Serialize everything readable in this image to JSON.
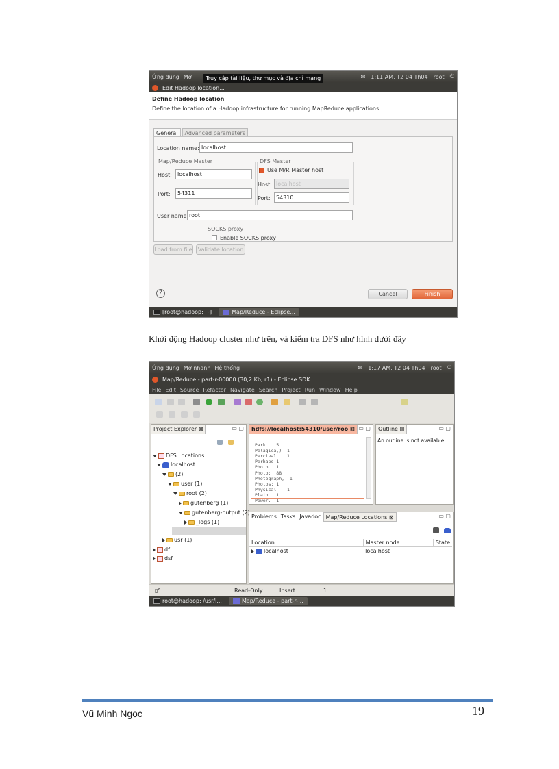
{
  "screenshot1": {
    "topbar": {
      "apps": "Ứng dụng",
      "places": "Mơ",
      "clock": "1:11 AM, T2 04 Th04",
      "user": "root"
    },
    "tooltip": "Truy cập tài liệu, thư mục và địa chỉ mạng",
    "dialog_title": "Edit Hadoop location...",
    "header_title": "Define Hadoop location",
    "header_desc": "Define the location of a Hadoop infrastructure for running MapReduce applications.",
    "tabs": [
      "General",
      "Advanced parameters"
    ],
    "location_name_label": "Location name:",
    "location_name_value": "localhost",
    "mr_master_title": "Map/Reduce Master",
    "mr_host_label": "Host:",
    "mr_host_value": "localhost",
    "mr_port_label": "Port:",
    "mr_port_value": "54311",
    "dfs_master_title": "DFS Master",
    "use_mr_host_label": "Use M/R Master host",
    "dfs_host_label": "Host:",
    "dfs_host_value": "localhost",
    "dfs_port_label": "Port:",
    "dfs_port_value": "54310",
    "username_label": "User name:",
    "username_value": "root",
    "socks_title": "SOCKS proxy",
    "enable_socks_label": "Enable SOCKS proxy",
    "load_from_file": "Load from file",
    "validate_location": "Validate location",
    "cancel": "Cancel",
    "finish": "Finish",
    "help_glyph": "?",
    "taskbar": [
      "[root@hadoop: ~]",
      "Map/Reduce - Eclipse..."
    ]
  },
  "caption": "Khởi động Hadoop cluster như trên, và kiểm tra DFS như hình dưới đây",
  "screenshot2": {
    "topbar": {
      "apps": "Ứng dụng",
      "places": "Mơ nhanh",
      "system": "Hệ thống",
      "clock": "1:17 AM, T2 04 Th04",
      "user": "root"
    },
    "window_title": "Map/Reduce - part-r-00000 (30,2 Kb, r1) - Eclipse SDK",
    "menu": [
      "File",
      "Edit",
      "Source",
      "Refactor",
      "Navigate",
      "Search",
      "Project",
      "Run",
      "Window",
      "Help"
    ],
    "project_explorer_tab": "Project Explorer ⊠",
    "tree": [
      {
        "label": "DFS Locations",
        "level": 0
      },
      {
        "label": "localhost",
        "level": 1
      },
      {
        "label": "(2)",
        "level": 2
      },
      {
        "label": "user (1)",
        "level": 3
      },
      {
        "label": "root (2)",
        "level": 4
      },
      {
        "label": "gutenberg (1)",
        "level": 5
      },
      {
        "label": "gutenberg-output (2)",
        "level": 5
      },
      {
        "label": "_logs (1)",
        "level": 6
      },
      {
        "label": "usr (1)",
        "level": 3
      },
      {
        "label": "df",
        "level": 0
      },
      {
        "label": "dsf",
        "level": 0
      }
    ],
    "editor_tab": "hdfs://localhost:54310/user/roo ⊠",
    "editor_lines": [
      "Park.   5",
      "Pelagica,)  1",
      "Percival    1",
      "Perhaps 1",
      "Photo   1",
      "Photo:  88",
      "Photograph,  1",
      "Photos: 1",
      "Physical    1",
      "Plain   1",
      "Power.  1"
    ],
    "outline_tab": "Outline ⊠",
    "outline_msg": "An outline is not available.",
    "bottom_tabs": [
      "Problems",
      "Tasks",
      "Javadoc",
      "Map/Reduce Locations ⊠"
    ],
    "locations_table": {
      "headers": [
        "Location",
        "Master node",
        "State"
      ],
      "rows": [
        [
          "localhost",
          "localhost",
          ""
        ]
      ]
    },
    "status": {
      "mode": "Read-Only",
      "insert": "Insert",
      "pos": "1 :"
    },
    "taskbar": [
      "root@hadoop: /usr/l...",
      "Map/Reduce - part-r-..."
    ]
  },
  "footer": {
    "author": "Vũ Minh Ngọc",
    "page_number": "19"
  }
}
